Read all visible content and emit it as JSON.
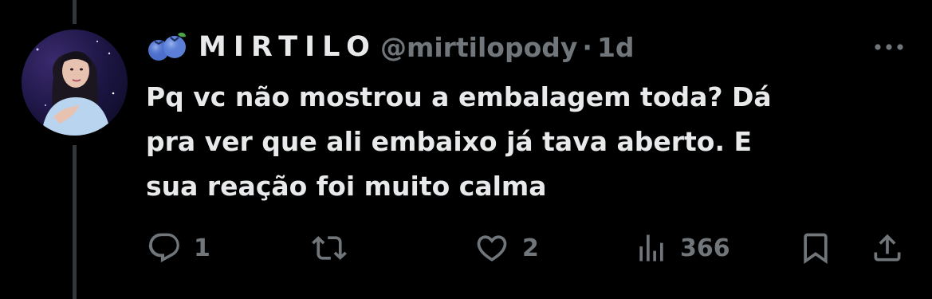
{
  "tweet": {
    "author": {
      "display_name": "MIRTILO",
      "handle": "@mirtilopody",
      "name_icon": "blueberry-icon"
    },
    "separator": "·",
    "time": "1d",
    "text_lines": [
      "Pq vc não mostrou a embalagem toda? Dá",
      "pra ver que ali embaixo já tava aberto. E",
      "sua reação foi muito calma"
    ],
    "more_icon": "more-horizontal-icon"
  },
  "actions": {
    "reply": {
      "icon": "reply-icon",
      "count": "1"
    },
    "retweet": {
      "icon": "retweet-icon",
      "count": ""
    },
    "like": {
      "icon": "heart-icon",
      "count": "2"
    },
    "views": {
      "icon": "views-icon",
      "count": "366"
    },
    "bookmark": {
      "icon": "bookmark-icon"
    },
    "share": {
      "icon": "share-icon"
    }
  },
  "colors": {
    "background": "#000000",
    "primary_text": "#e7e9ea",
    "secondary_text": "#71767b",
    "thread_line": "#333639",
    "blueberry": "#5b7fd6"
  }
}
